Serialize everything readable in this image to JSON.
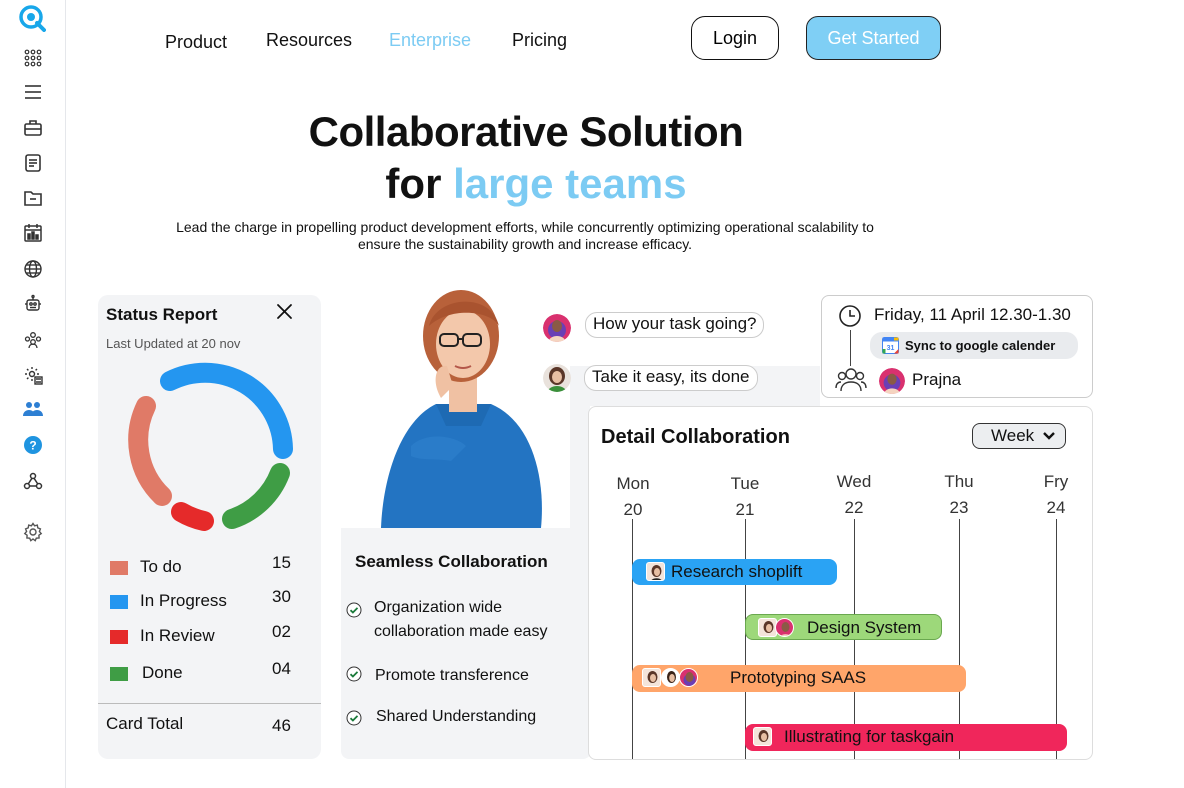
{
  "nav": {
    "links": [
      "Product",
      "Resources",
      "Enterprise",
      "Pricing"
    ],
    "login": "Login",
    "get_started": "Get Started"
  },
  "rail_icons": [
    "logo-icon",
    "apps-grid-icon",
    "menu-icon",
    "briefcase-icon",
    "document-icon",
    "folder-icon",
    "calendar-chart-icon",
    "globe-icon",
    "robot-icon",
    "team-icon",
    "settings-gear-icon",
    "users-group-icon",
    "help-icon",
    "webhook-icon",
    "settings-icon"
  ],
  "hero": {
    "title_line1": "Collaborative Solution",
    "title_line2_prefix": "for",
    "title_line2_accent": "large teams",
    "subtitle": "Lead the charge in propelling product development efforts, while concurrently optimizing operational scalability to ensure the sustainability growth and increase efficacy."
  },
  "status_report": {
    "title": "Status Report",
    "updated": "Last Updated at 20 nov",
    "items": [
      {
        "label": "To do",
        "value": "15",
        "color": "#e07a67"
      },
      {
        "label": "In Progress",
        "value": "30",
        "color": "#2496f0"
      },
      {
        "label": "In Review",
        "value": "02",
        "color": "#e52a2a"
      },
      {
        "label": "Done",
        "value": "04",
        "color": "#3f9d45"
      }
    ],
    "total_label": "Card Total",
    "total_value": "46"
  },
  "collab": {
    "title": "Seamless Collaboration",
    "features": [
      "Organization wide collaboration made easy",
      "Promote transference",
      "Shared Understanding"
    ]
  },
  "chat": {
    "msg1": "How your task going?",
    "msg2": "Take it easy, its done"
  },
  "event": {
    "datetime": "Friday, 11 April  12.30-1.30",
    "sync": "Sync to google calender",
    "name": "Prajna"
  },
  "detail": {
    "title": "Detail Collaboration",
    "range": "Week",
    "days": [
      {
        "name": "Mon",
        "num": "20"
      },
      {
        "name": "Tue",
        "num": "21"
      },
      {
        "name": "Wed",
        "num": "22"
      },
      {
        "name": "Thu",
        "num": "23"
      },
      {
        "name": "Fry",
        "num": "24"
      }
    ],
    "tasks": [
      {
        "label": "Research shoplift",
        "color": "#2aa3f4"
      },
      {
        "label": "Design System",
        "color": "#9dd87a"
      },
      {
        "label": "Prototyping SAAS",
        "color": "#ffa56a"
      },
      {
        "label": "Illustrating for taskgain",
        "color": "#f0265b"
      }
    ]
  }
}
